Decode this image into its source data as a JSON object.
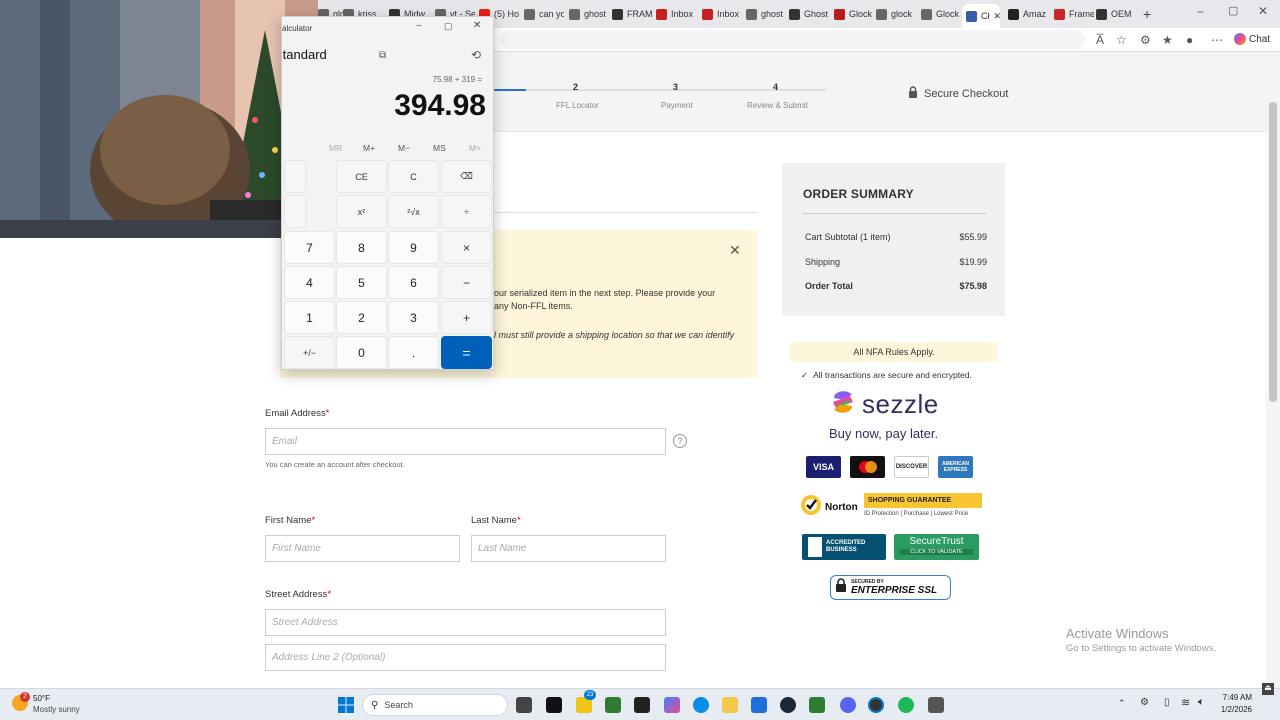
{
  "browser": {
    "tabs": [
      {
        "label": "glock",
        "color": "#666"
      },
      {
        "label": "kriss",
        "color": "#666"
      },
      {
        "label": "Midw",
        "color": "#333"
      },
      {
        "label": "vt - Se",
        "color": "#666"
      },
      {
        "label": "(5) Ho",
        "color": "#e62117"
      },
      {
        "label": "can yo",
        "color": "#666"
      },
      {
        "label": "ghost",
        "color": "#666"
      },
      {
        "label": "FRAM",
        "color": "#333"
      },
      {
        "label": "Inbox",
        "color": "#c5221f"
      },
      {
        "label": "Inbox",
        "color": "#c5221f"
      },
      {
        "label": "ghost",
        "color": "#666"
      },
      {
        "label": "Ghost",
        "color": "#333"
      },
      {
        "label": "Glock",
        "color": "#b71c1c"
      },
      {
        "label": "glock",
        "color": "#666"
      },
      {
        "label": "Glock",
        "color": "#666"
      },
      {
        "label": "Cł",
        "color": "#3b5ba5"
      },
      {
        "label": "Amaz",
        "color": "#222"
      },
      {
        "label": "Frame",
        "color": "#c62828"
      },
      {
        "label": "OEM",
        "color": "#333"
      }
    ],
    "chat_label": "Chat"
  },
  "checkout": {
    "steps": [
      {
        "num": "2",
        "label": "FFL Locator"
      },
      {
        "num": "3",
        "label": "Payment"
      },
      {
        "num": "4",
        "label": "Review & Submit"
      }
    ],
    "secure_checkout": "Secure Checkout",
    "notice": {
      "line1": "our serialized item in the next step. Please provide your",
      "line2": "any Non-FFL items.",
      "line3": "ill must still provide a shipping location so that we can identify"
    },
    "form": {
      "email_label": "Email Address",
      "email_placeholder": "Email",
      "email_hint": "You can create an account after checkout.",
      "first_name_label": "First Name",
      "first_name_placeholder": "First Name",
      "last_name_label": "Last Name",
      "last_name_placeholder": "Last Name",
      "street_label": "Street Address",
      "street_placeholder": "Street Address",
      "address2_placeholder": "Address Line 2 (Optional)",
      "required_mark": "*"
    }
  },
  "summary": {
    "title": "ORDER SUMMARY",
    "rows": [
      {
        "label": "Cart Subtotal (1 item)",
        "value": "$55.99"
      },
      {
        "label": "Shipping",
        "value": "$19.99"
      },
      {
        "label": "Order Total",
        "value": "$75.98"
      }
    ],
    "nfa": "All NFA Rules Apply.",
    "secure_text": "All transactions are secure and encrypted.",
    "sezzle": "sezzle",
    "sezzle_tagline": "Buy now, pay later.",
    "cards": [
      "VISA",
      "",
      "DISCOVER",
      "AMERICAN EXPRESS"
    ],
    "norton": "Norton",
    "shopping_guarantee": "SHOPPING GUARANTEE",
    "shopping_sub": "ID Protection | Purchase | Lowest Price",
    "bbb": "ACCREDITED BUSINESS",
    "securetrust_title": "SecureTrust",
    "securetrust_sub": "CLICK TO VALIDATE",
    "ssl_top": "SECURED BY",
    "ssl_main": "ENTERPRISE SSL"
  },
  "activate_windows": {
    "title": "Activate Windows",
    "subtitle": "Go to Settings to activate Windows."
  },
  "calculator": {
    "title": "alculator",
    "mode": "Standard",
    "expression": "75.98 + 319 =",
    "display": "394.98",
    "memory": [
      "MR",
      "M+",
      "M−",
      "MS",
      "M˅"
    ],
    "buttons": {
      "ce": "CE",
      "c": "C",
      "back": "⌫",
      "sq": "x²",
      "sqrt": "²√x",
      "div": "÷",
      "n7": "7",
      "n8": "8",
      "n9": "9",
      "mul": "×",
      "n4": "4",
      "n5": "5",
      "n6": "6",
      "sub": "−",
      "n1": "1",
      "n2": "2",
      "n3": "3",
      "add": "+",
      "neg": "+/−",
      "n0": "0",
      "dot": ".",
      "eq": "="
    }
  },
  "taskbar": {
    "weather_temp": "50°F",
    "weather_desc": "Mostly sunny",
    "weather_badge": "2",
    "search": "Search",
    "time": "7:49 AM",
    "date": "1/2/2026",
    "badge_count": "23"
  }
}
